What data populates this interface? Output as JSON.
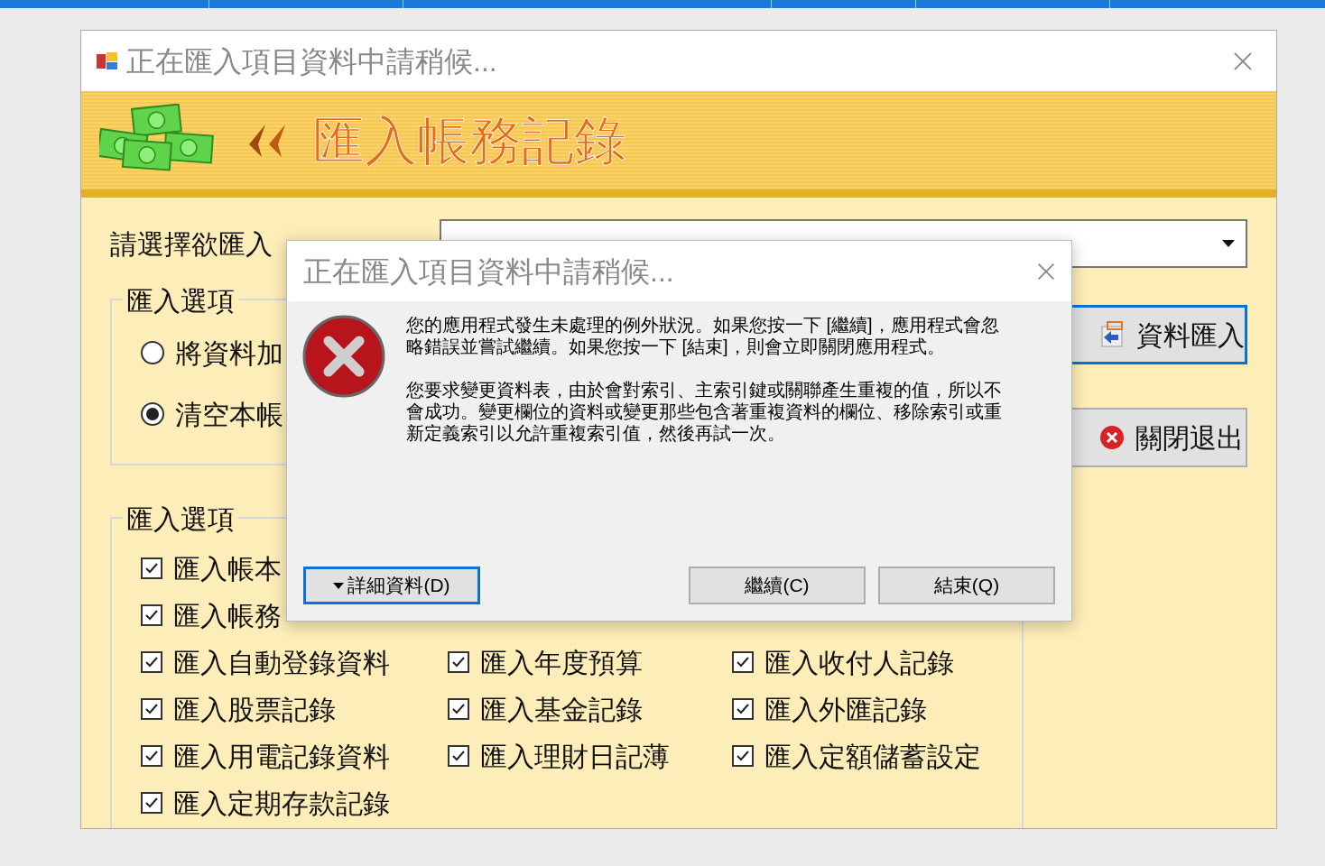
{
  "window": {
    "title": "正在匯入項目資料中請稍候..."
  },
  "banner": {
    "title": "匯入帳務記錄"
  },
  "file_label": "請選擇欲匯入",
  "mode_group": {
    "title": "匯入選項",
    "options": [
      {
        "label": "將資料加",
        "selected": false
      },
      {
        "label": "清空本帳",
        "selected": true
      }
    ]
  },
  "side_buttons": [
    {
      "label": "資料匯入",
      "kind": "import",
      "focused": true
    },
    {
      "label": "關閉退出",
      "kind": "close",
      "focused": false
    }
  ],
  "import_group": {
    "title": "匯入選項",
    "rows": [
      [
        {
          "label": "匯入帳本",
          "checked": true
        }
      ],
      [
        {
          "label": "匯入帳務",
          "checked": true
        }
      ],
      [
        {
          "label": "匯入自動登錄資料",
          "checked": true
        },
        {
          "label": "匯入年度預算",
          "checked": true
        },
        {
          "label": "匯入收付人記錄",
          "checked": true
        }
      ],
      [
        {
          "label": "匯入股票記錄",
          "checked": true
        },
        {
          "label": "匯入基金記錄",
          "checked": true
        },
        {
          "label": "匯入外匯記錄",
          "checked": true
        }
      ],
      [
        {
          "label": "匯入用電記錄資料",
          "checked": true
        },
        {
          "label": "匯入理財日記薄",
          "checked": true
        },
        {
          "label": "匯入定額儲蓄設定",
          "checked": true
        }
      ],
      [
        {
          "label": "匯入定期存款記錄",
          "checked": true
        }
      ]
    ]
  },
  "dialog": {
    "title": "正在匯入項目資料中請稍候...",
    "paragraphs": [
      "您的應用程式發生未處理的例外狀況。如果您按一下 [繼續]，應用程式會忽略錯誤並嘗試繼續。如果您按一下 [結束]，則會立即關閉應用程式。",
      "您要求變更資料表，由於會對索引、主索引鍵或關聯產生重複的值，所以不會成功。變更欄位的資料或變更那些包含著重複資料的欄位、移除索引或重新定義索引以允許重複索引值，然後再試一次。"
    ],
    "buttons": [
      {
        "label": "詳細資料(D)",
        "kind": "details",
        "focused": true
      },
      {
        "label": "繼續(C)",
        "kind": "plain",
        "focused": false
      },
      {
        "label": "結束(Q)",
        "kind": "plain",
        "focused": false
      }
    ]
  }
}
